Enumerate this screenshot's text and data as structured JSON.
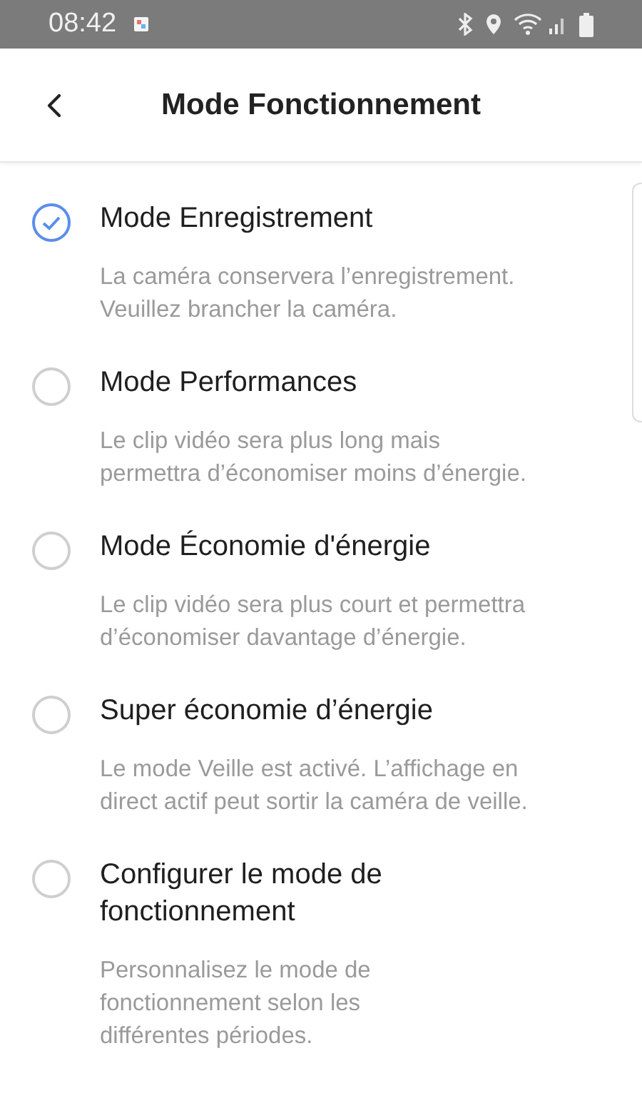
{
  "status_bar": {
    "time": "08:42"
  },
  "header": {
    "title": "Mode Fonctionnement"
  },
  "modes": [
    {
      "title": "Mode Enregistrement",
      "description": "La caméra conservera l’enregistrement.\nVeuillez brancher la caméra.",
      "selected": true
    },
    {
      "title": "Mode Performances",
      "description": "Le clip vidéo sera plus long mais\npermettra d’économiser moins d’énergie.",
      "selected": false
    },
    {
      "title": "Mode Économie d'énergie",
      "description": "Le clip vidéo sera plus court et permettra\nd’économiser davantage d’énergie.",
      "selected": false
    },
    {
      "title": "Super économie d’énergie",
      "description": "Le mode Veille est activé. L’affichage en\ndirect actif peut sortir la caméra de veille.",
      "selected": false
    },
    {
      "title": "Configurer le mode de\nfonctionnement",
      "description": "Personnalisez le mode de\nfonctionnement selon les\ndifférentes périodes.",
      "selected": false
    }
  ]
}
